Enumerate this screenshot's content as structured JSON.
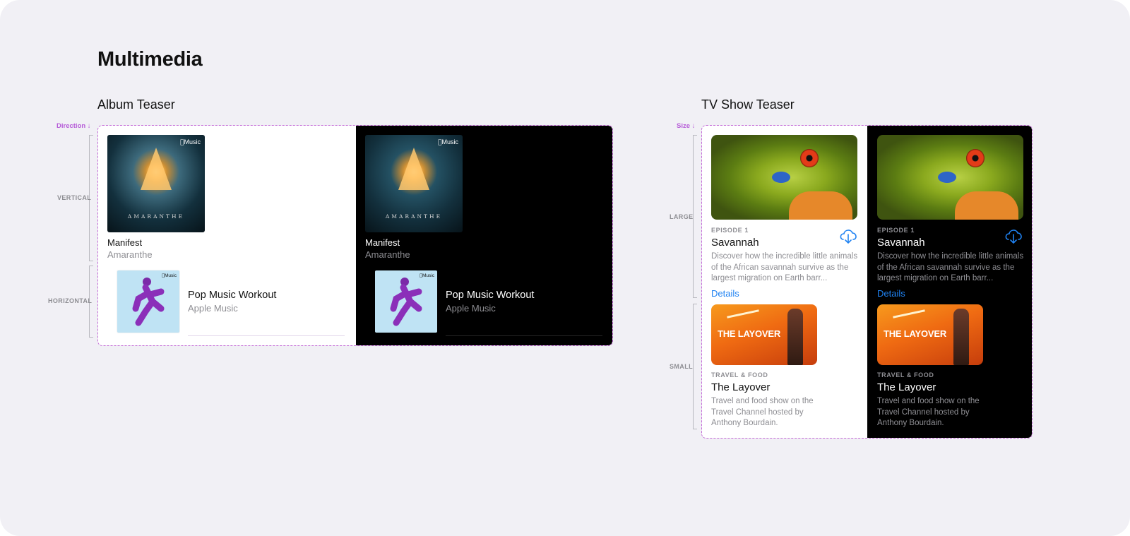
{
  "page": {
    "title": "Multimedia"
  },
  "album_teaser": {
    "section_title": "Album Teaser",
    "axis_label": "Direction ↓",
    "variants": [
      "VERTICAL",
      "HORIZONTAL"
    ],
    "vertical_item": {
      "title": "Manifest",
      "subtitle": "Amaranthe",
      "art_badge": "Music",
      "art_text": "AMARANTHE"
    },
    "horizontal_item": {
      "title": "Pop Music Workout",
      "subtitle": "Apple Music",
      "art_badge": "Music"
    }
  },
  "tv_teaser": {
    "section_title": "TV Show Teaser",
    "axis_label": "Size ↓",
    "variants": [
      "LARGE",
      "SMALL"
    ],
    "large_item": {
      "eyebrow": "EPISODE 1",
      "title": "Savannah",
      "description": "Discover how the incredible little animals of the African savannah survive as the largest migration on Earth barr...",
      "link": "Details"
    },
    "small_item": {
      "eyebrow": "TRAVEL & FOOD",
      "title": "The Layover",
      "description": "Travel and food show on the Travel Channel hosted by Anthony Bourdain.",
      "art_title": "THE LAYOVER"
    }
  },
  "colors": {
    "background": "#f1f0f5",
    "accent_dashed": "#c46ad7",
    "link": "#1f82f2",
    "secondary_text": "#8e8e93"
  },
  "icons": [
    "apple-logo-icon",
    "cloud-download-icon"
  ]
}
